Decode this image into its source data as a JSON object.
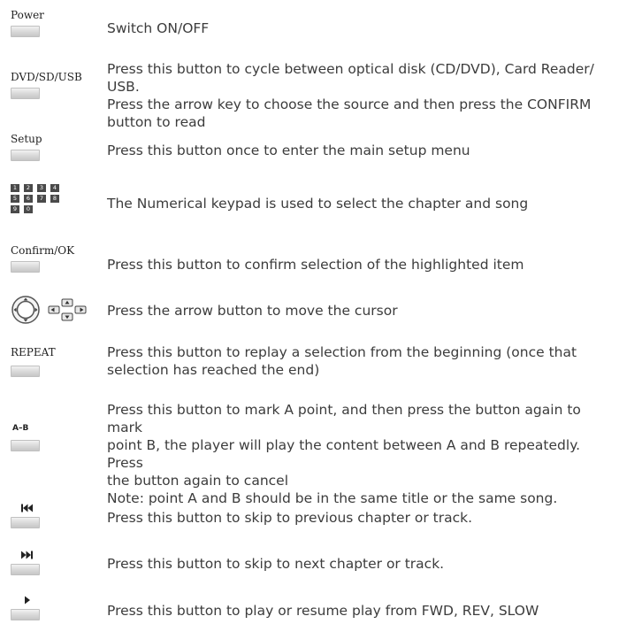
{
  "rows": [
    {
      "button": "Power",
      "desc": [
        "Switch ON/OFF"
      ]
    },
    {
      "button": "DVD/SD/USB",
      "desc": [
        "Press this button to cycle between optical disk (CD/DVD), Card Reader/ USB.",
        "Press the arrow key to choose the source and then press the CONFIRM",
        "button to read"
      ]
    },
    {
      "button": "Setup",
      "desc": [
        "Press this button once to enter the main setup menu"
      ]
    },
    {
      "keys": [
        "1",
        "2",
        "3",
        "4",
        "5",
        "6",
        "7",
        "8",
        "9",
        "0"
      ],
      "desc": [
        "The Numerical keypad is used to select the chapter and song"
      ]
    },
    {
      "button": "Confirm/OK",
      "desc": [
        "Press this button to confirm selection of the highlighted item"
      ]
    },
    {
      "icon": "arrow-pad-icon",
      "desc": [
        "Press the arrow button to move the cursor"
      ]
    },
    {
      "button": "REPEAT",
      "desc": [
        "Press this button to replay a selection from the beginning (once that",
        "selection has reached the end)"
      ]
    },
    {
      "button": "A–B",
      "desc": [
        "Press this button to mark A point, and then press the button again to mark",
        "point B, the player will play the content between A and B repeatedly. Press",
        "the button again to cancel",
        "Note: point A and B should be in the same title or the same song."
      ]
    },
    {
      "icon": "skip-previous-icon",
      "desc": [
        "Press this button to skip to previous chapter or track."
      ]
    },
    {
      "icon": "skip-next-icon",
      "desc": [
        "Press this button to skip to next chapter or track."
      ]
    },
    {
      "icon": "play-icon",
      "desc": [
        "Press this button to play or resume play from FWD, REV, SLOW"
      ]
    }
  ]
}
